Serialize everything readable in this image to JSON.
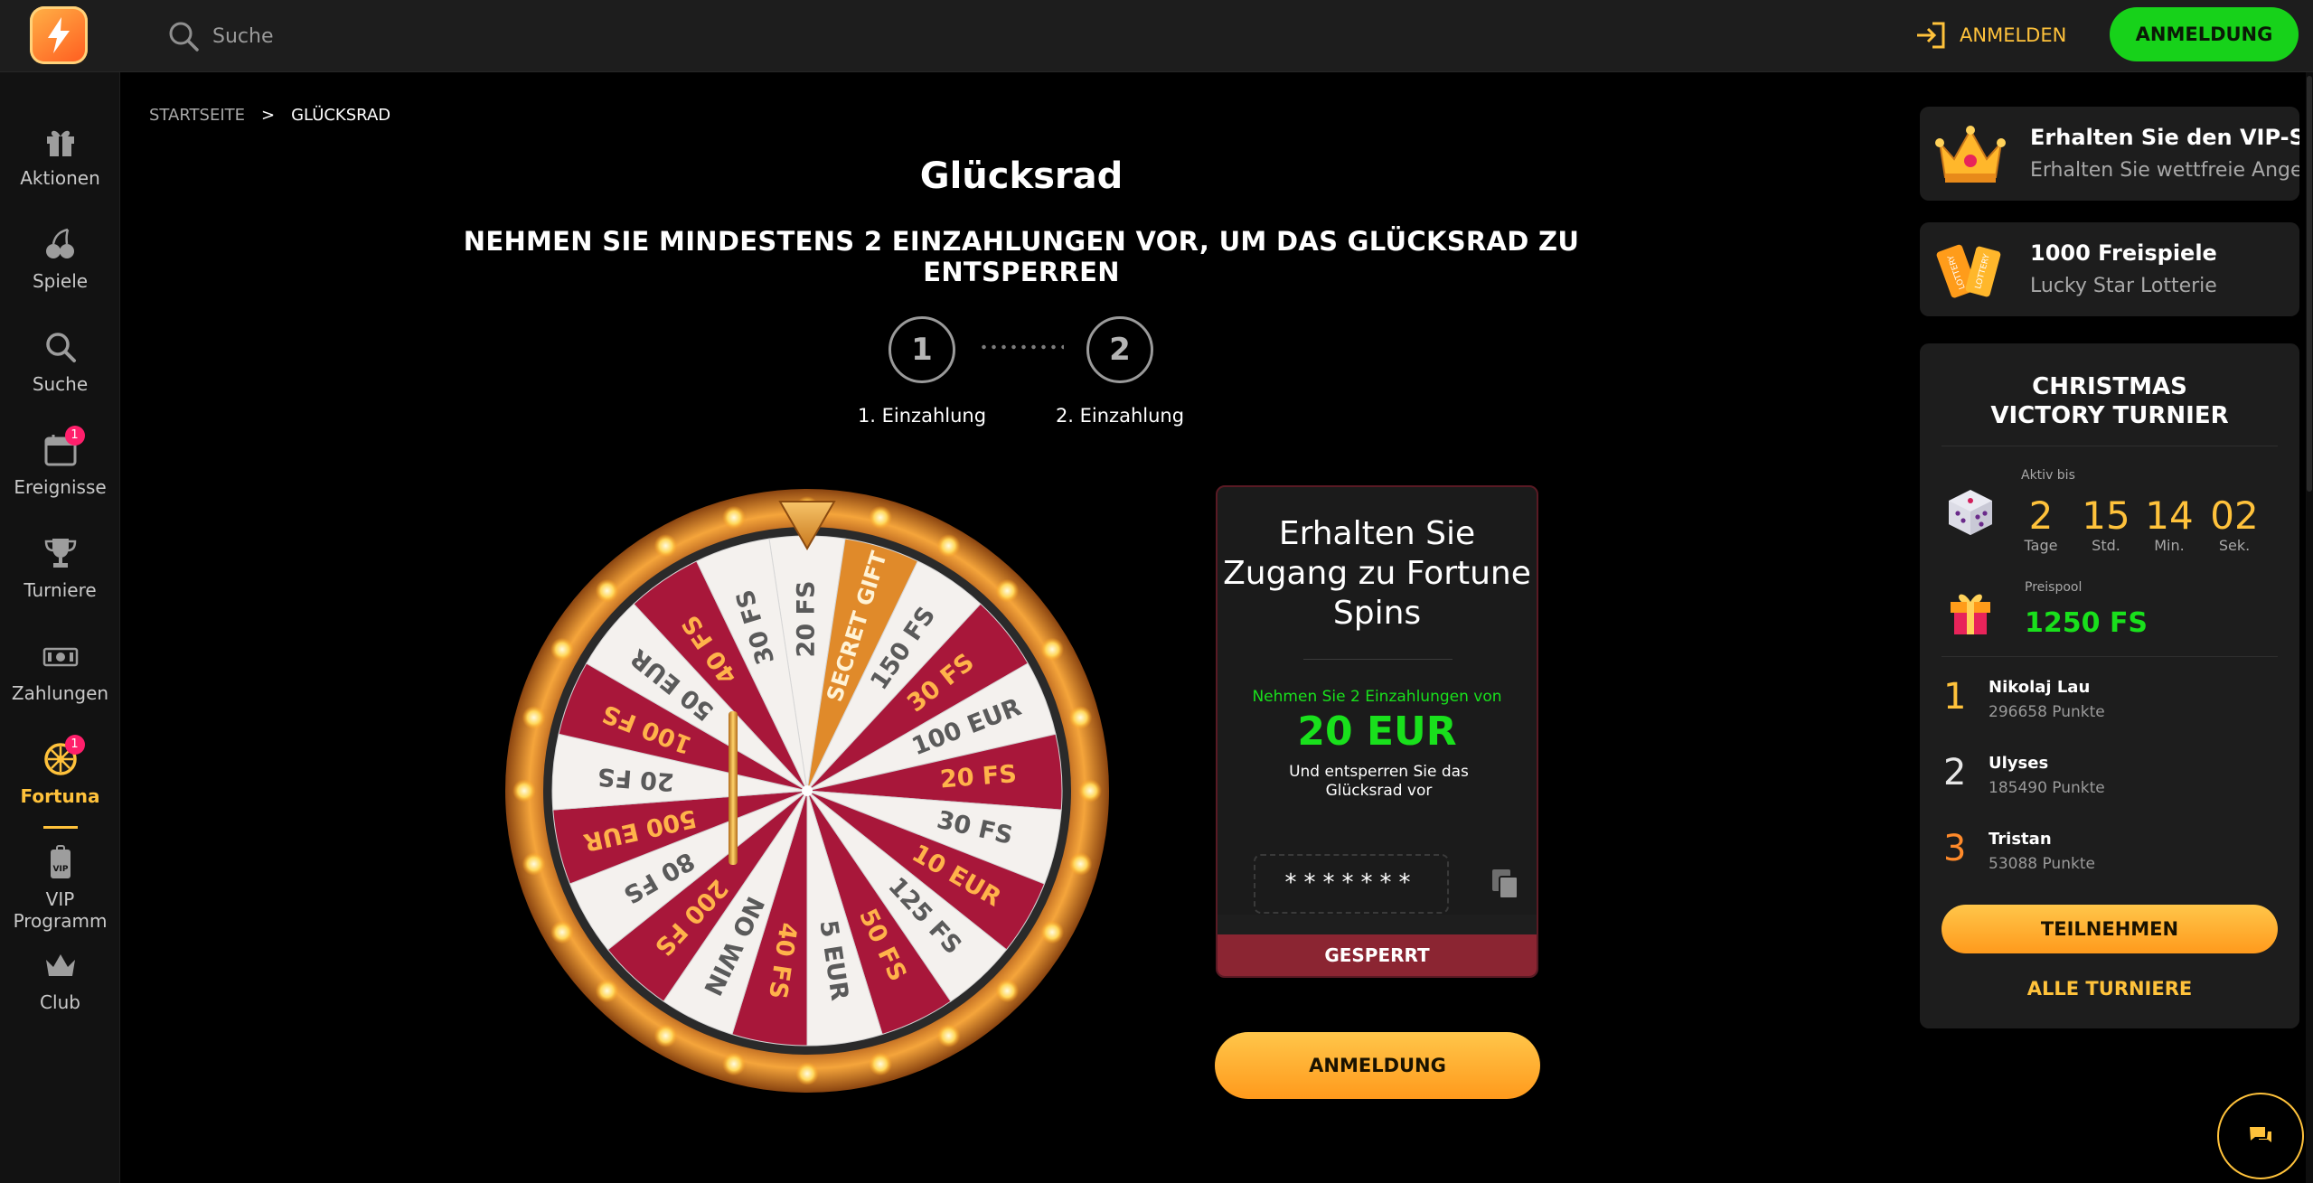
{
  "header": {
    "search_placeholder": "Suche",
    "login_label": "ANMELDEN",
    "signup_label": "ANMELDUNG"
  },
  "sidebar": {
    "items": [
      {
        "label": "Aktionen",
        "icon": "gift-icon"
      },
      {
        "label": "Spiele",
        "icon": "cherries-icon"
      },
      {
        "label": "Suche",
        "icon": "search-icon"
      },
      {
        "label": "Ereignisse",
        "icon": "calendar-icon",
        "badge": "1"
      },
      {
        "label": "Turniere",
        "icon": "trophy-icon"
      },
      {
        "label": "Zahlungen",
        "icon": "cash-icon"
      },
      {
        "label": "Fortuna",
        "icon": "wheel-icon",
        "badge": "1",
        "active": true
      },
      {
        "label": "VIP Programm",
        "icon": "vip-icon"
      },
      {
        "label": "Club",
        "icon": "crown-icon"
      }
    ]
  },
  "breadcrumb": {
    "home": "STARTSEITE",
    "sep": ">",
    "current": "GLÜCKSRAD"
  },
  "page": {
    "title": "Glücksrad",
    "subtitle": "NEHMEN SIE MINDESTENS 2 EINZAHLUNGEN VOR, UM DAS GLÜCKSRAD ZU ENTSPERREN",
    "steps": [
      {
        "num": "1",
        "label": "1. Einzahlung"
      },
      {
        "num": "2",
        "label": "2. Einzahlung"
      }
    ]
  },
  "wheel": {
    "segments": [
      "20 FS",
      "SECRET GIFT",
      "150 FS",
      "30 FS",
      "100 EUR",
      "20 FS",
      "30 FS",
      "10 EUR",
      "125 FS",
      "50 FS",
      "5 EUR",
      "40 FS",
      "NO WIN",
      "200 FS",
      "80 FS",
      "500 EUR",
      "20 FS",
      "100 FS",
      "50 EUR",
      "40 FS",
      "30 FS"
    ]
  },
  "card": {
    "title": "Erhalten Sie Zugang zu Fortune Spins",
    "requirement": "Nehmen Sie 2 Einzahlungen von",
    "amount": "20 EUR",
    "unlock_text": "Und entsperren Sie das Glücksrad vor",
    "code": "*******",
    "locked_label": "GESPERRT",
    "signup_label": "ANMELDUNG"
  },
  "promos": [
    {
      "title": "Erhalten Sie den VIP-S...",
      "subtitle": "Erhalten Sie wettfreie Angeb...",
      "icon": "crown-icon"
    },
    {
      "title": "1000 Freispiele",
      "subtitle": "Lucky Star Lotterie",
      "icon": "lottery-ticket-icon"
    }
  ],
  "tournament": {
    "title": "CHRISTMAS VICTORY TURNIER",
    "active_label": "Aktiv bis",
    "countdown": [
      {
        "value": "2",
        "unit": "Tage"
      },
      {
        "value": "15",
        "unit": "Std."
      },
      {
        "value": "14",
        "unit": "Min."
      },
      {
        "value": "02",
        "unit": "Sek."
      }
    ],
    "pool_label": "Preispool",
    "pool_value": "1250 FS",
    "leaders": [
      {
        "rank": "1",
        "name": "Nikolaj Lau",
        "points": "296658 Punkte",
        "color": "#ffc23b"
      },
      {
        "rank": "2",
        "name": "Ulyses",
        "points": "185490 Punkte",
        "color": "#e6e6e6"
      },
      {
        "rank": "3",
        "name": "Tristan",
        "points": "53088 Punkte",
        "color": "#ff8a2a"
      }
    ],
    "join_label": "TEILNEHMEN",
    "all_label": "ALLE TURNIERE"
  },
  "colors": {
    "accent_yellow": "#ffc23b",
    "green": "#17d21a",
    "wheel_red": "#a8173a",
    "locked_red": "#8b2532"
  }
}
